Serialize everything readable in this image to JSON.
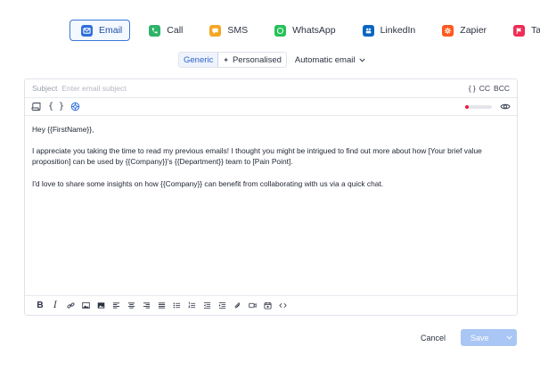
{
  "channels": [
    {
      "label": "Email",
      "icon": "envelope-icon",
      "color": "#2f6fdb",
      "active": true
    },
    {
      "label": "Call",
      "icon": "phone-icon",
      "color": "#2fb36a",
      "active": false
    },
    {
      "label": "SMS",
      "icon": "chat-bubble-icon",
      "color": "#f5a623",
      "active": false
    },
    {
      "label": "WhatsApp",
      "icon": "whatsapp-icon",
      "color": "#25c15a",
      "active": false
    },
    {
      "label": "LinkedIn",
      "icon": "linkedin-icon",
      "color": "#0a66c2",
      "active": false
    },
    {
      "label": "Zapier",
      "icon": "zapier-icon",
      "color": "#ff5a1f",
      "active": false
    },
    {
      "label": "Task",
      "icon": "flag-icon",
      "color": "#ef2d56",
      "active": false
    }
  ],
  "modes": {
    "generic": "Generic",
    "personalised": "Personalised",
    "automatic": "Automatic email"
  },
  "editor": {
    "subject_label": "Subject",
    "subject_placeholder": "Enter email subject",
    "cc_braces": "{ }",
    "cc": "CC",
    "bcc": "BCC",
    "spam_score_fraction": 0.12,
    "body": [
      "Hey {{FirstName}},",
      "I appreciate you taking the time to read my previous emails! I thought you might be intrigued to find out more about how [Your brief value proposition] can be used by {{Company}}'s {{Department}} team to [Pain Point].",
      "I'd love to share some insights on how {{Company}} can benefit from collaborating with us via a quick chat."
    ]
  },
  "footer": {
    "cancel": "Cancel",
    "save": "Save"
  },
  "colors": {
    "accent": "#3a78d8",
    "save_disabled": "#a9c6f4",
    "spam_indicator": "#e8193e"
  }
}
